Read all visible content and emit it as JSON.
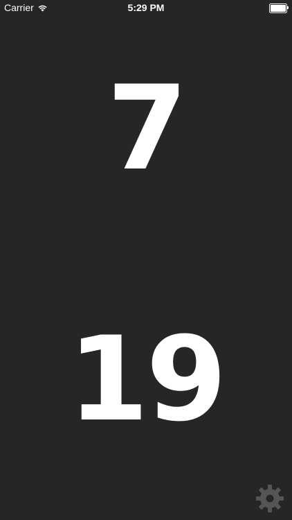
{
  "status_bar": {
    "carrier": "Carrier",
    "time": "5:29 PM",
    "wifi_icon": "wifi-icon",
    "battery_icon": "battery-full-icon",
    "battery_level": 1.0
  },
  "main": {
    "top_number": "7",
    "bottom_number": "19"
  },
  "settings": {
    "icon": "gear-icon"
  },
  "colors": {
    "background": "#262626",
    "text": "#ffffff",
    "gear": "#555555"
  }
}
